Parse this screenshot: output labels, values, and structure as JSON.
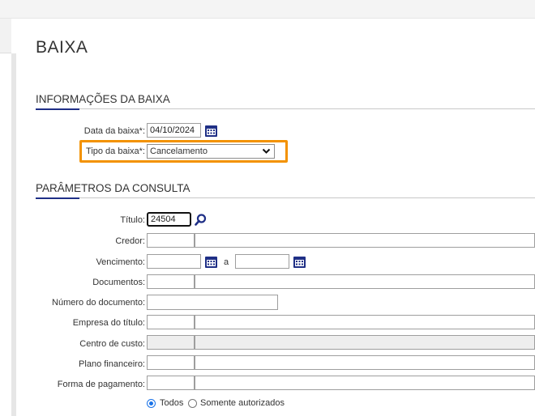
{
  "page": {
    "title": "BAIXA"
  },
  "info_section": {
    "title": "INFORMAÇÕES DA BAIXA",
    "data_label": "Data da baixa*:",
    "data_value": "04/10/2024",
    "tipo_label": "Tipo da baixa*:",
    "tipo_value": "Cancelamento"
  },
  "params_section": {
    "title": "PARÂMETROS DA CONSULTA",
    "titulo_label": "Título:",
    "titulo_value": "24504",
    "credor_label": "Credor:",
    "vencimento_label": "Vencimento:",
    "vencimento_sep": "a",
    "documentos_label": "Documentos:",
    "numero_label": "Número do documento:",
    "empresa_label": "Empresa do título:",
    "centro_label": "Centro de custo:",
    "plano_label": "Plano financeiro:",
    "forma_label": "Forma de pagamento:",
    "radio_todos": "Todos",
    "radio_autorizados": "Somente autorizados",
    "radio_selected": "Todos"
  },
  "colors": {
    "accent": "#1f2f86",
    "highlight": "#f39200",
    "radio": "#1a73e8"
  },
  "icons": {
    "calendar": "calendar-icon",
    "search": "search-icon",
    "chevron": "chevron-down-icon"
  }
}
